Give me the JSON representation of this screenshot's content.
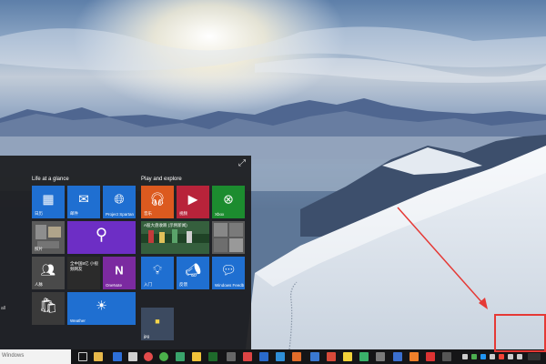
{
  "start_menu": {
    "group1_title": "Life at a glance",
    "group2_title": "Play and explore",
    "rail_text": "all",
    "tiles": {
      "calculator": "日历",
      "mail": "邮件",
      "project_spartan": "Project Spartan",
      "photos": "照片",
      "search": "",
      "people": "人脉",
      "people_news": "全中国8亿 小视频网友",
      "onenote": "OneNote",
      "store": "",
      "weather": "Weather",
      "music": "音乐",
      "video": "视频",
      "xbox": "Xbox",
      "money": "A股大盘收跌 (示例新闻)",
      "sports": "",
      "news": "",
      "getstarted": "入门",
      "feedback": "反馈",
      "windows_feedback": "Windows Feedb",
      "jpg": "jpg"
    }
  },
  "taskbar": {
    "search_placeholder": "Windows"
  },
  "colors": {
    "tile_blue": "#1f6fd1",
    "tile_orange": "#dc5a1f",
    "tile_red": "#b8233a",
    "tile_green": "#1c8c2f",
    "tile_purple": "#6d2ec5",
    "annotation_red": "#e53935"
  }
}
